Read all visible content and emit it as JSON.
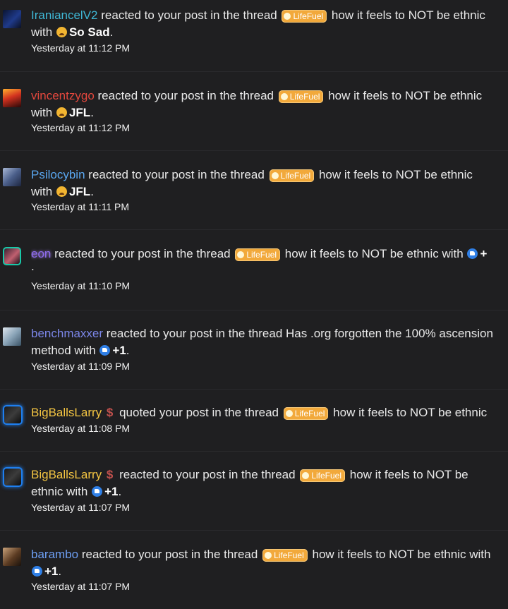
{
  "notifications": [
    {
      "username": "IraniancelV2",
      "username_color": "cyan",
      "badge": "",
      "action": "reacted to your post in the thread",
      "prefix": "LifeFuel",
      "thread": "how it feels to NOT be ethnic",
      "line2_before": "with",
      "reaction_icon": "sad-face-icon",
      "reaction": "So Sad",
      "line2_after": ".",
      "time": "Yesterday at 11:12 PM"
    },
    {
      "username": "vincentzygo",
      "username_color": "red",
      "badge": "",
      "action": "reacted to your post in the thread",
      "prefix": "LifeFuel",
      "thread": "how it feels to NOT be ethnic",
      "line2_before": "with",
      "reaction_icon": "laughing-face-icon",
      "reaction": "JFL",
      "line2_after": ".",
      "time": "Yesterday at 11:12 PM"
    },
    {
      "username": "Psilocybin",
      "username_color": "blue",
      "badge": "",
      "action": "reacted to your post in the thread",
      "prefix": "LifeFuel",
      "thread": "how it feels to NOT be ethnic",
      "line2_before": "with",
      "reaction_icon": "laughing-face-icon",
      "reaction": "JFL",
      "line2_after": ".",
      "time": "Yesterday at 11:11 PM"
    },
    {
      "username": "eon",
      "username_color": "purple",
      "badge": "",
      "action": "reacted to your post in the thread",
      "prefix": "LifeFuel",
      "thread": "how it feels to NOT be ethnic with",
      "reaction_icon": "thumbs-up-icon",
      "reaction": "+",
      "line2_after": ".",
      "time": "Yesterday at 11:10 PM"
    },
    {
      "username": "benchmaxxer",
      "username_color": "indigo",
      "badge": "",
      "action": "reacted to your post in the thread",
      "thread": "Has .org forgotten the 100% ascension",
      "line2_before": "method with",
      "reaction_icon": "thumbs-up-icon",
      "reaction": "+1",
      "line2_after": ".",
      "time": "Yesterday at 11:09 PM"
    },
    {
      "username": "BigBallsLarry",
      "username_color": "yellow",
      "badge": "$",
      "action": "quoted your post in the thread",
      "prefix": "LifeFuel",
      "thread": "how it feels to NOT be ethnic",
      "time": "Yesterday at 11:08 PM"
    },
    {
      "username": "BigBallsLarry",
      "username_color": "yellow",
      "badge": "$",
      "action": "reacted to your post in the thread",
      "prefix": "LifeFuel",
      "thread": "how it feels to NOT be",
      "line2_before": "ethnic with",
      "reaction_icon": "thumbs-up-icon",
      "reaction": "+1",
      "line2_after": ".",
      "time": "Yesterday at 11:07 PM"
    },
    {
      "username": "barambo",
      "username_color": "blue2",
      "badge": "",
      "action": "reacted to your post in the thread",
      "prefix": "LifeFuel",
      "thread": "how it feels to NOT be ethnic with",
      "line2_before": "",
      "reaction_icon": "thumbs-up-icon",
      "reaction": "+1",
      "line2_after": ".",
      "time": "Yesterday at 11:07 PM"
    }
  ]
}
